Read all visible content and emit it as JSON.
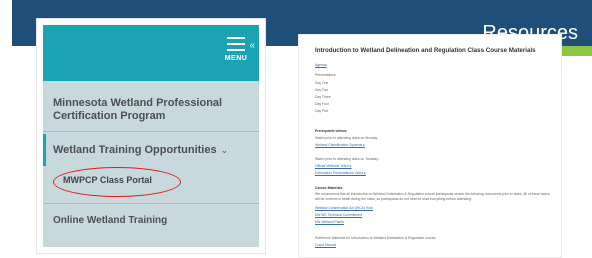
{
  "slide": {
    "title": "Resources",
    "colors": {
      "band": "#1f4e79",
      "accent": "#8dc63f"
    }
  },
  "menu": {
    "menu_label": "MENU",
    "header_color": "#1aa3b2",
    "items": [
      {
        "label": "Minnesota Wetland Professional Certification Program"
      },
      {
        "label": "Wetland Training Opportunities",
        "caret": "⌄"
      },
      {
        "label": "MWPCP Class Portal"
      },
      {
        "label": "Online Wetland Training"
      }
    ],
    "highlight_color": "#e11b1b"
  },
  "page": {
    "title": "Introduction to Wetland Delineation and Regulation Class Course Materials",
    "agenda_link": "Agenda",
    "presentations": "Presentations",
    "days": [
      "Day One",
      "Day Two",
      "Day Three",
      "Day Four",
      "Day Five"
    ],
    "prereq_heading": "Prerequisite videos:",
    "prereq_monday": "Watch prior to attending class on Monday:",
    "prereq_monday_link": "Wetland Classification Systems ▸",
    "prereq_tuesday": "Watch prior to attending class on Tuesday:",
    "prereq_tuesday_links": [
      "Official Methods Video ▸",
      "Delineation Presentations Video ▸"
    ],
    "course_heading": "Course Materials",
    "course_text": "We recommend that all Introduction to Wetland Delineation & Regulation course participants review the following documents prior to class. All of these topics will be covered in detail during the class, so participants do not need to read everything before attending.",
    "course_links": [
      "Wetland Conservation Act (WCA) Rule",
      "MN WC Technical Commitment",
      "MN Wetland Plants"
    ],
    "reference_text": "Reference Materials for Introduction to Wetland Delineation & Regulation course:",
    "reference_link": "Corps Manual"
  }
}
